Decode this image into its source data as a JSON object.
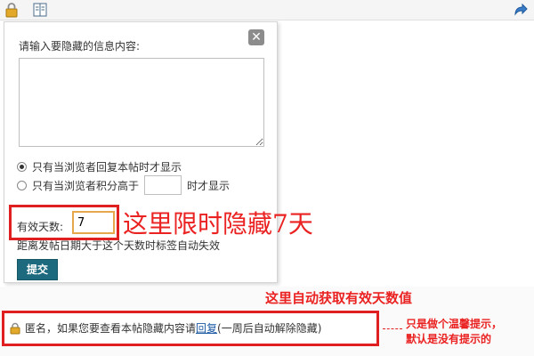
{
  "colors": {
    "annotation_red": "#ea2222",
    "submit_bg": "#1d6a7f",
    "link_blue": "#1d5aa3",
    "input_highlight": "#e6a74d"
  },
  "toolbar": {
    "icons": [
      "lock-icon",
      "document-icon",
      "share-arrow-icon"
    ]
  },
  "popup": {
    "close_label": "✕",
    "prompt": "请输入要隐藏的信息内容:",
    "content_value": "",
    "options": [
      {
        "label": "只有当浏览者回复本帖时才显示",
        "checked": true
      },
      {
        "label_before": "只有当浏览者积分高于",
        "label_after": "时才显示",
        "checked": false
      }
    ],
    "credit_value": "",
    "days_label": "有效天数:",
    "days_value": "7",
    "hint": "距离发帖日期大于这个天数时标签自动失效",
    "submit_label": "提交"
  },
  "annotations": {
    "days": "这里限时隐藏7天",
    "auto": "这里自动获取有效天数值",
    "tip_line1": "只是做个温馨提示，",
    "tip_line2": "默认是没有提示的"
  },
  "notice": {
    "prefix": "匿名，如果您要查看本帖隐藏内容请",
    "link": "回复",
    "suffix": "(一周后自动解除隐藏)"
  }
}
